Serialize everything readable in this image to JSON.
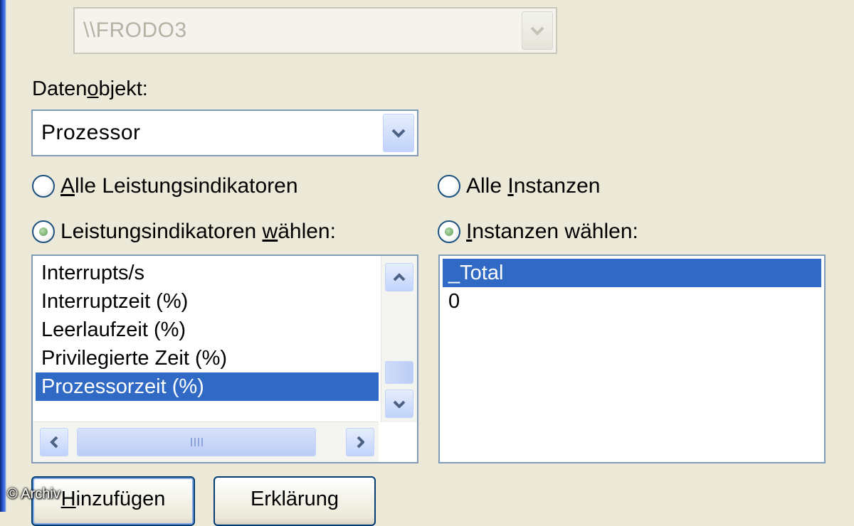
{
  "computer": {
    "value": "\\\\FRODO3",
    "disabled": true
  },
  "data_object": {
    "label_before": "Daten",
    "label_accel": "o",
    "label_after": "bjekt:",
    "value": "Prozessor"
  },
  "counters": {
    "all_option": {
      "accel": "A",
      "rest": "lle Leistungsindikatoren",
      "selected": false
    },
    "select_option": {
      "before": "Leistungsindikatoren ",
      "accel": "w",
      "after": "ählen:",
      "selected": true
    },
    "items": [
      {
        "label": "Interrupts/s",
        "selected": false
      },
      {
        "label": "Interruptzeit (%)",
        "selected": false
      },
      {
        "label": "Leerlaufzeit (%)",
        "selected": false
      },
      {
        "label": "Privilegierte Zeit (%)",
        "selected": false
      },
      {
        "label": "Prozessorzeit (%)",
        "selected": true
      }
    ]
  },
  "instances": {
    "all_option": {
      "before": "Alle ",
      "accel": "I",
      "after": "nstanzen",
      "selected": false
    },
    "select_option": {
      "accel": "I",
      "after": "nstanzen wählen:",
      "selected": true
    },
    "items": [
      {
        "label": "_Total",
        "selected": true
      },
      {
        "label": "0",
        "selected": false
      }
    ]
  },
  "buttons": {
    "add": {
      "accel": "H",
      "rest": "inzufügen"
    },
    "explain": {
      "label": "Erklärung"
    }
  },
  "watermark": "© Archiv",
  "colors": {
    "selection": "#316ac5",
    "dialog_bg": "#ece9d8",
    "field_border": "#7f9db9"
  }
}
